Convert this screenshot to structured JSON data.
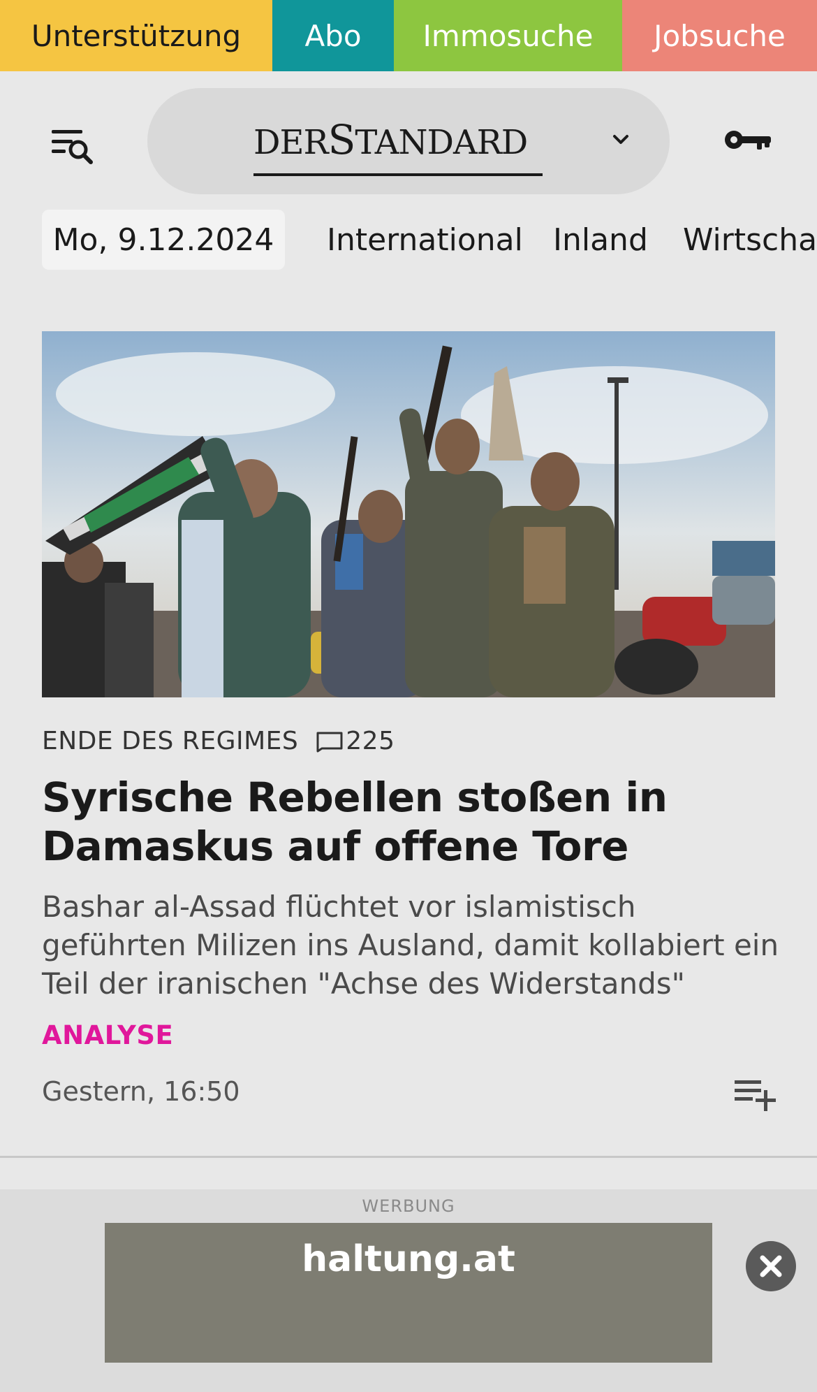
{
  "topbar": {
    "support": "Unterstützung",
    "abo": "Abo",
    "immo": "Immosuche",
    "jobs": "Jobsuche"
  },
  "header": {
    "logo_prefix": "DER",
    "logo_main_S": "S",
    "logo_main_rest": "TANDARD"
  },
  "nav": {
    "date": "Mo, 9.12.2024",
    "items": [
      "International",
      "Inland",
      "Wirtschaft"
    ]
  },
  "article": {
    "kicker": "ENDE DES REGIMES",
    "comments": "225",
    "headline": "Syrische Rebellen stoßen in Damaskus auf offene Tore",
    "lead": "Bashar al-Assad flüchtet vor islamistisch geführten Milizen ins Ausland, damit kollabiert ein Teil der iranischen \"Achse des Widerstands\"",
    "tag": "ANALYSE",
    "timestamp": "Gestern, 16:50"
  },
  "ad": {
    "label": "WERBUNG",
    "text": "haltung.at"
  },
  "colors": {
    "support": "#f5c542",
    "abo": "#10969a",
    "immo": "#8dc640",
    "jobs": "#ec8578",
    "tag": "#e0179b"
  },
  "icons": [
    "menu-search-icon",
    "chevron-down-icon",
    "key-icon",
    "comment-icon",
    "playlist-add-icon",
    "close-icon"
  ]
}
